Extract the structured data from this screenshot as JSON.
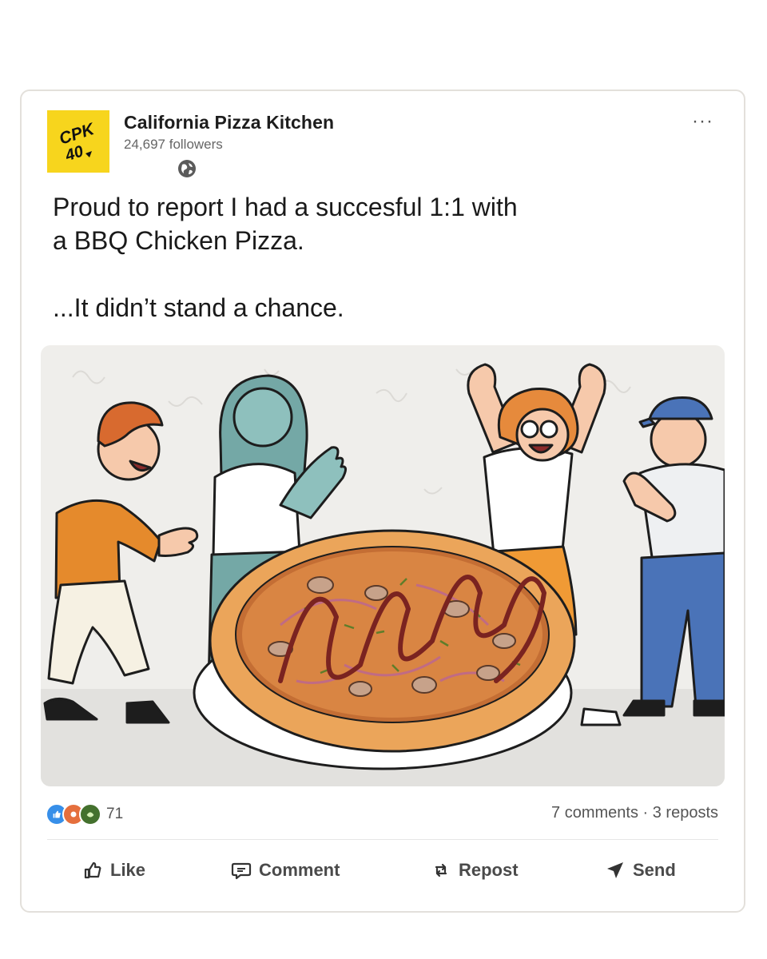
{
  "post": {
    "author": "California Pizza Kitchen",
    "followers": "24,697 followers",
    "logo_text_top": "CPK",
    "logo_text_bottom": "40",
    "more_label": "···",
    "text_line1": "Proud to report I had a succesful 1:1 with",
    "text_line2": "a BBQ Chicken Pizza.",
    "text_line3": "...It didn’t stand a chance."
  },
  "social": {
    "reaction_count": "71",
    "comments": "7 comments",
    "separator": "·",
    "reposts": "3 reposts"
  },
  "actions": {
    "like": "Like",
    "comment": "Comment",
    "repost": "Repost",
    "send": "Send"
  },
  "colors": {
    "logo_bg": "#f7d51d",
    "text": "#1a1a1a",
    "muted": "#666666"
  }
}
